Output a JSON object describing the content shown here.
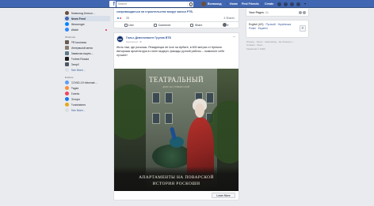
{
  "topbar": {
    "logo": "f",
    "search_placeholder": "Search",
    "username": "Всеволод",
    "links": [
      "Home",
      "Find Friends",
      "Create"
    ]
  },
  "sidebar": {
    "profile_name": "Всеволод Копыл…",
    "main_items": [
      {
        "label": "News Feed",
        "active": true,
        "icon": "news-feed-icon",
        "color": "#4267b2"
      },
      {
        "label": "Messenger",
        "icon": "messenger-icon",
        "color": "#0084ff"
      },
      {
        "label": "Watch",
        "icon": "watch-icon",
        "color": "#2d88ff",
        "dot": true
      }
    ],
    "shortcuts_heading": "Shortcuts",
    "shortcut_items": [
      {
        "label": "PR business",
        "icon": "group-icon",
        "color": "#6a5a52"
      },
      {
        "label": "Интервьюй меня",
        "icon": "group-icon",
        "color": "#8a7c6e"
      },
      {
        "label": "Заявочки ищем…",
        "icon": "group-icon",
        "color": "#5e7a8c"
      },
      {
        "label": "Forbes Russia",
        "icon": "page-icon",
        "color": "#1d1d1d"
      },
      {
        "label": "Deepl!",
        "icon": "page-icon",
        "color": "#4f5966"
      }
    ],
    "see_more": "See More...",
    "explore_heading": "Explore",
    "explore_items": [
      {
        "label": "COVID-19 Informat…",
        "icon": "covid-info-icon",
        "color": "#5d9df5"
      },
      {
        "label": "Pages",
        "icon": "flag-icon",
        "color": "#f7923b"
      },
      {
        "label": "Events",
        "icon": "calendar-icon",
        "color": "#f3425f"
      },
      {
        "label": "Groups",
        "icon": "groups-icon",
        "color": "#1877f2"
      },
      {
        "label": "Fundraisers",
        "icon": "fundraiser-icon",
        "color": "#e5a81b"
      }
    ],
    "see_more_2": "See More..."
  },
  "feed": {
    "top_post": {
      "title": "сопровождаться на строительстве вокруг жилья РТБ.",
      "reactions_count": "28",
      "shares": "4 Shares"
    },
    "actions": {
      "like": "Like",
      "comment": "Comment",
      "share": "Share"
    },
    "post": {
      "author": "Гольс Девелопмент Группа ВТБ",
      "sponsored": "Sponsored · ⚙",
      "text_1": "Жить там, где роскошь. Резиденции de luxe на Арбате, в 600 метрах от Кремля.",
      "text_2": "Авторская архитектура в стиле модерн, фасады ручной работы – позвольте себе лучшее!",
      "ad": {
        "title": "ТЕАТРАЛЬНЫЙ",
        "subtitle": "ДОМ НА ПОВАРСКОЙ",
        "bottom_line_1": "АПАРТАМЕНТЫ НА ПОВАРСКОЙ",
        "bottom_line_2": "ИСТОРИЯ РОСКОШИ"
      },
      "cta": "Learn More"
    }
  },
  "right": {
    "your_pages": "Your Pages",
    "pages_count": "(9)",
    "languages": {
      "line_1_current": "English (US)",
      "line_1_rest": " · Русский · Українська",
      "line_2": "Polski · Español"
    },
    "footer": {
      "line_1": "Privacy · Terms · Advertising · Ad Choices ▷ ·",
      "line_2": "Cookies · More ·",
      "line_3": "Facebook © 2020"
    }
  }
}
